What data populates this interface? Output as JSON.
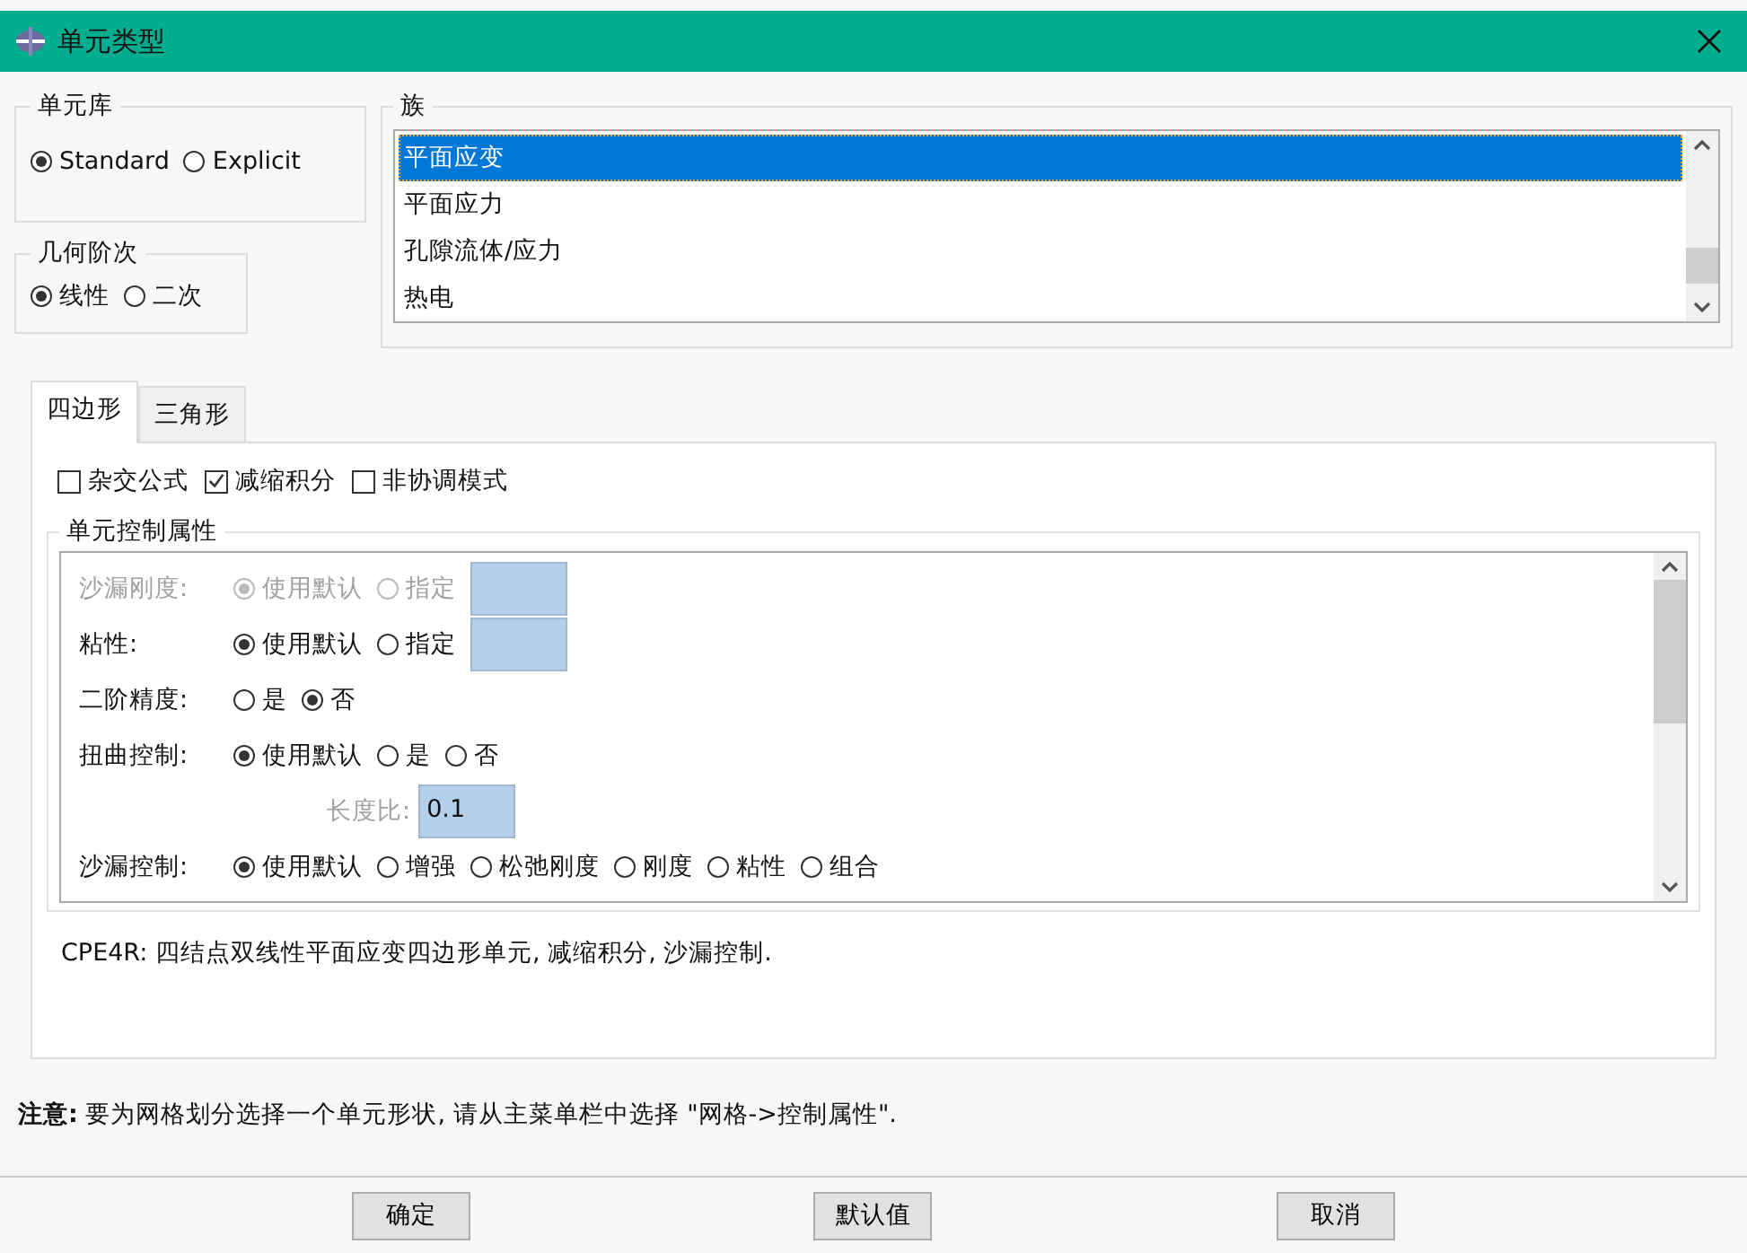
{
  "window": {
    "title": "单元类型"
  },
  "element_library": {
    "label": "单元库",
    "options": [
      {
        "label": "Standard",
        "selected": true
      },
      {
        "label": "Explicit",
        "selected": false
      }
    ]
  },
  "geometric_order": {
    "label": "几何阶次",
    "options": [
      {
        "label": "线性",
        "selected": true
      },
      {
        "label": "二次",
        "selected": false
      }
    ]
  },
  "family": {
    "label": "族",
    "items": [
      {
        "label": "平面应变",
        "selected": true
      },
      {
        "label": "平面应力",
        "selected": false
      },
      {
        "label": "孔隙流体/应力",
        "selected": false
      },
      {
        "label": "热电",
        "selected": false
      }
    ]
  },
  "tabs": [
    {
      "label": "四边形",
      "selected": true
    },
    {
      "label": "三角形",
      "selected": false
    }
  ],
  "options": [
    {
      "label": "杂交公式",
      "checked": false
    },
    {
      "label": "减缩积分",
      "checked": true
    },
    {
      "label": "非协调模式",
      "checked": false
    }
  ],
  "element_controls": {
    "label": "单元控制属性",
    "rows": [
      {
        "kind": "radio",
        "label": "沙漏刚度:",
        "disabled": true,
        "has_field": true,
        "options": [
          {
            "label": "使用默认",
            "selected": true
          },
          {
            "label": "指定",
            "selected": false
          }
        ]
      },
      {
        "kind": "radio",
        "label": "粘性:",
        "disabled": false,
        "has_field": true,
        "options": [
          {
            "label": "使用默认",
            "selected": true
          },
          {
            "label": "指定",
            "selected": false
          }
        ]
      },
      {
        "kind": "radio",
        "label": "二阶精度:",
        "disabled": false,
        "has_field": false,
        "options": [
          {
            "label": "是",
            "selected": false
          },
          {
            "label": "否",
            "selected": true
          }
        ]
      },
      {
        "kind": "radio",
        "label": "扭曲控制:",
        "disabled": false,
        "has_field": false,
        "options": [
          {
            "label": "使用默认",
            "selected": true
          },
          {
            "label": "是",
            "selected": false
          },
          {
            "label": "否",
            "selected": false
          }
        ]
      },
      {
        "kind": "field",
        "label": "长度比:",
        "disabled": true,
        "value": "0.1"
      },
      {
        "kind": "radio",
        "label": "沙漏控制:",
        "disabled": false,
        "has_field": false,
        "options": [
          {
            "label": "使用默认",
            "selected": true
          },
          {
            "label": "增强",
            "selected": false
          },
          {
            "label": "松弛刚度",
            "selected": false
          },
          {
            "label": "刚度",
            "selected": false
          },
          {
            "label": "粘性",
            "selected": false
          },
          {
            "label": "组合",
            "selected": false
          }
        ]
      }
    ]
  },
  "description": "CPE4R:  四结点双线性平面应变四边形单元,  减缩积分, 沙漏控制.",
  "note": {
    "label": "注意:",
    "text": "要为网格划分选择一个单元形状, 请从主菜单栏中选择 \"网格->控制属性\"."
  },
  "buttons": [
    "确定",
    "默认值",
    "取消"
  ]
}
